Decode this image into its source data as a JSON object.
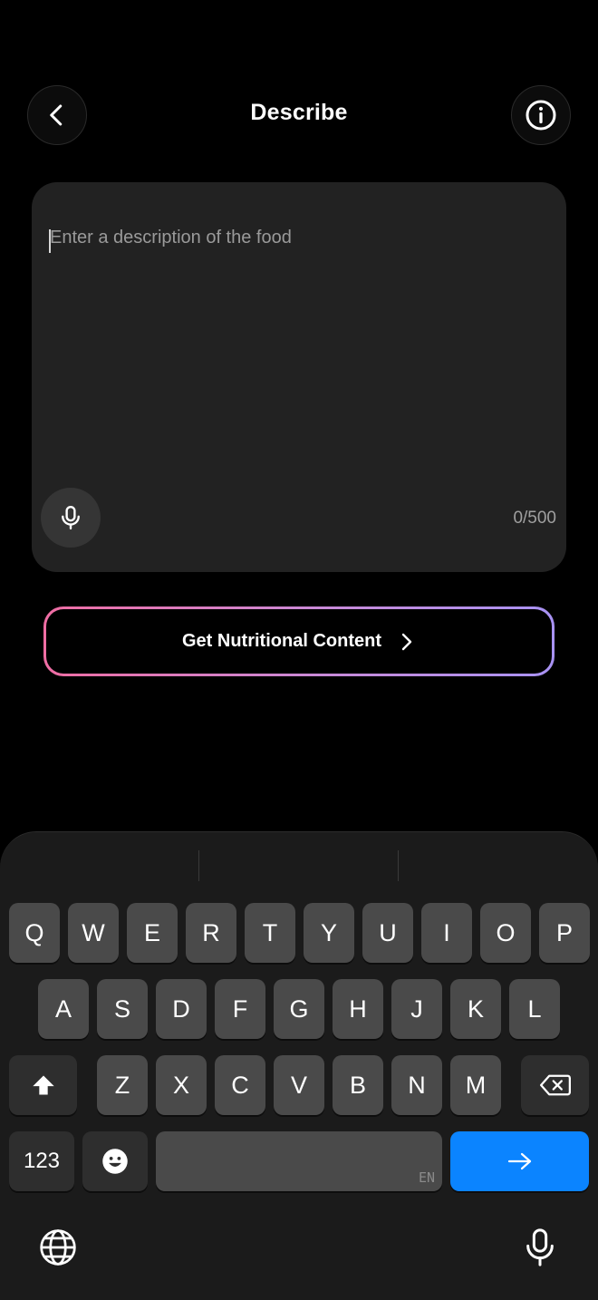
{
  "header": {
    "title": "Describe",
    "back_icon": "chevron-left-icon",
    "info_icon": "info-icon"
  },
  "description": {
    "placeholder": "Enter a description of the food",
    "value": "",
    "counter": "0/500",
    "mic_icon": "microphone-icon"
  },
  "cta": {
    "label": "Get Nutritional Content",
    "icon": "chevron-right-icon",
    "gradient_start": "#ef6da3",
    "gradient_end": "#a892f3"
  },
  "keyboard": {
    "row1": [
      "Q",
      "W",
      "E",
      "R",
      "T",
      "Y",
      "U",
      "I",
      "O",
      "P"
    ],
    "row2": [
      "A",
      "S",
      "D",
      "F",
      "G",
      "H",
      "J",
      "K",
      "L"
    ],
    "row3": [
      "Z",
      "X",
      "C",
      "V",
      "B",
      "N",
      "M"
    ],
    "numbers_label": "123",
    "space_lang": "EN",
    "shift_icon": "shift-icon",
    "delete_icon": "backspace-icon",
    "emoji_icon": "emoji-icon",
    "return_icon": "arrow-right-icon",
    "globe_icon": "globe-icon",
    "dictation_icon": "microphone-icon",
    "accent_color": "#0b84ff"
  }
}
